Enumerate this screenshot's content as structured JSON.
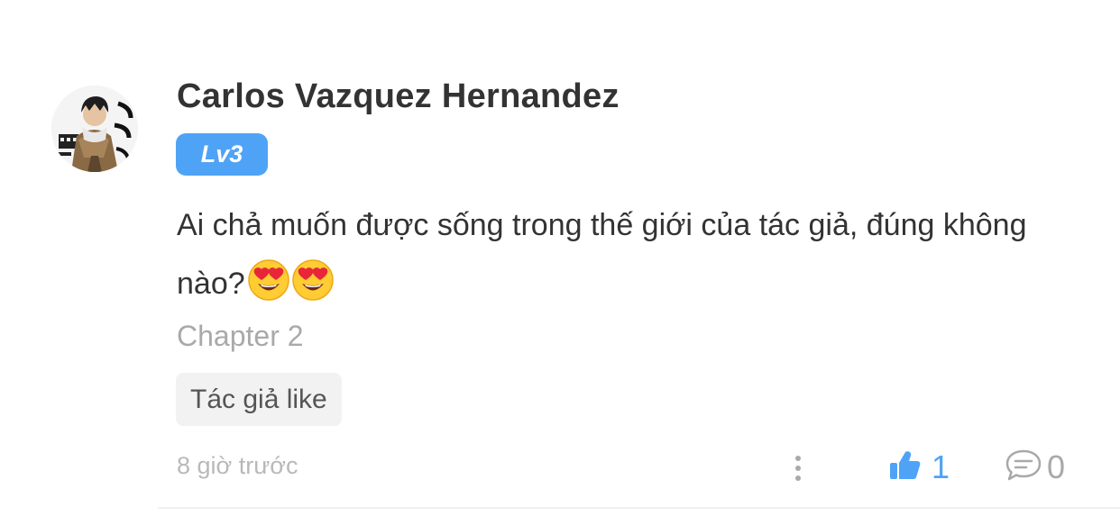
{
  "comment": {
    "author": "Carlos Vazquez Hernandez",
    "level": "Lv3",
    "text": "Ai chả muốn được sống trong thế giới của tác giả, đúng không nào?",
    "chapter": "Chapter 2",
    "tag": "Tác giả like",
    "timestamp": "8 giờ trước",
    "likes": "1",
    "replies": "0"
  },
  "colors": {
    "accent": "#4fa3f7",
    "text": "#333333",
    "muted": "#a9a9a9"
  },
  "icons": {
    "avatar": "avatar-anime-character",
    "emoji": "heart-eyes-emoji",
    "more": "more-vertical-icon",
    "like": "thumbs-up-icon",
    "reply": "chat-bubble-icon"
  }
}
